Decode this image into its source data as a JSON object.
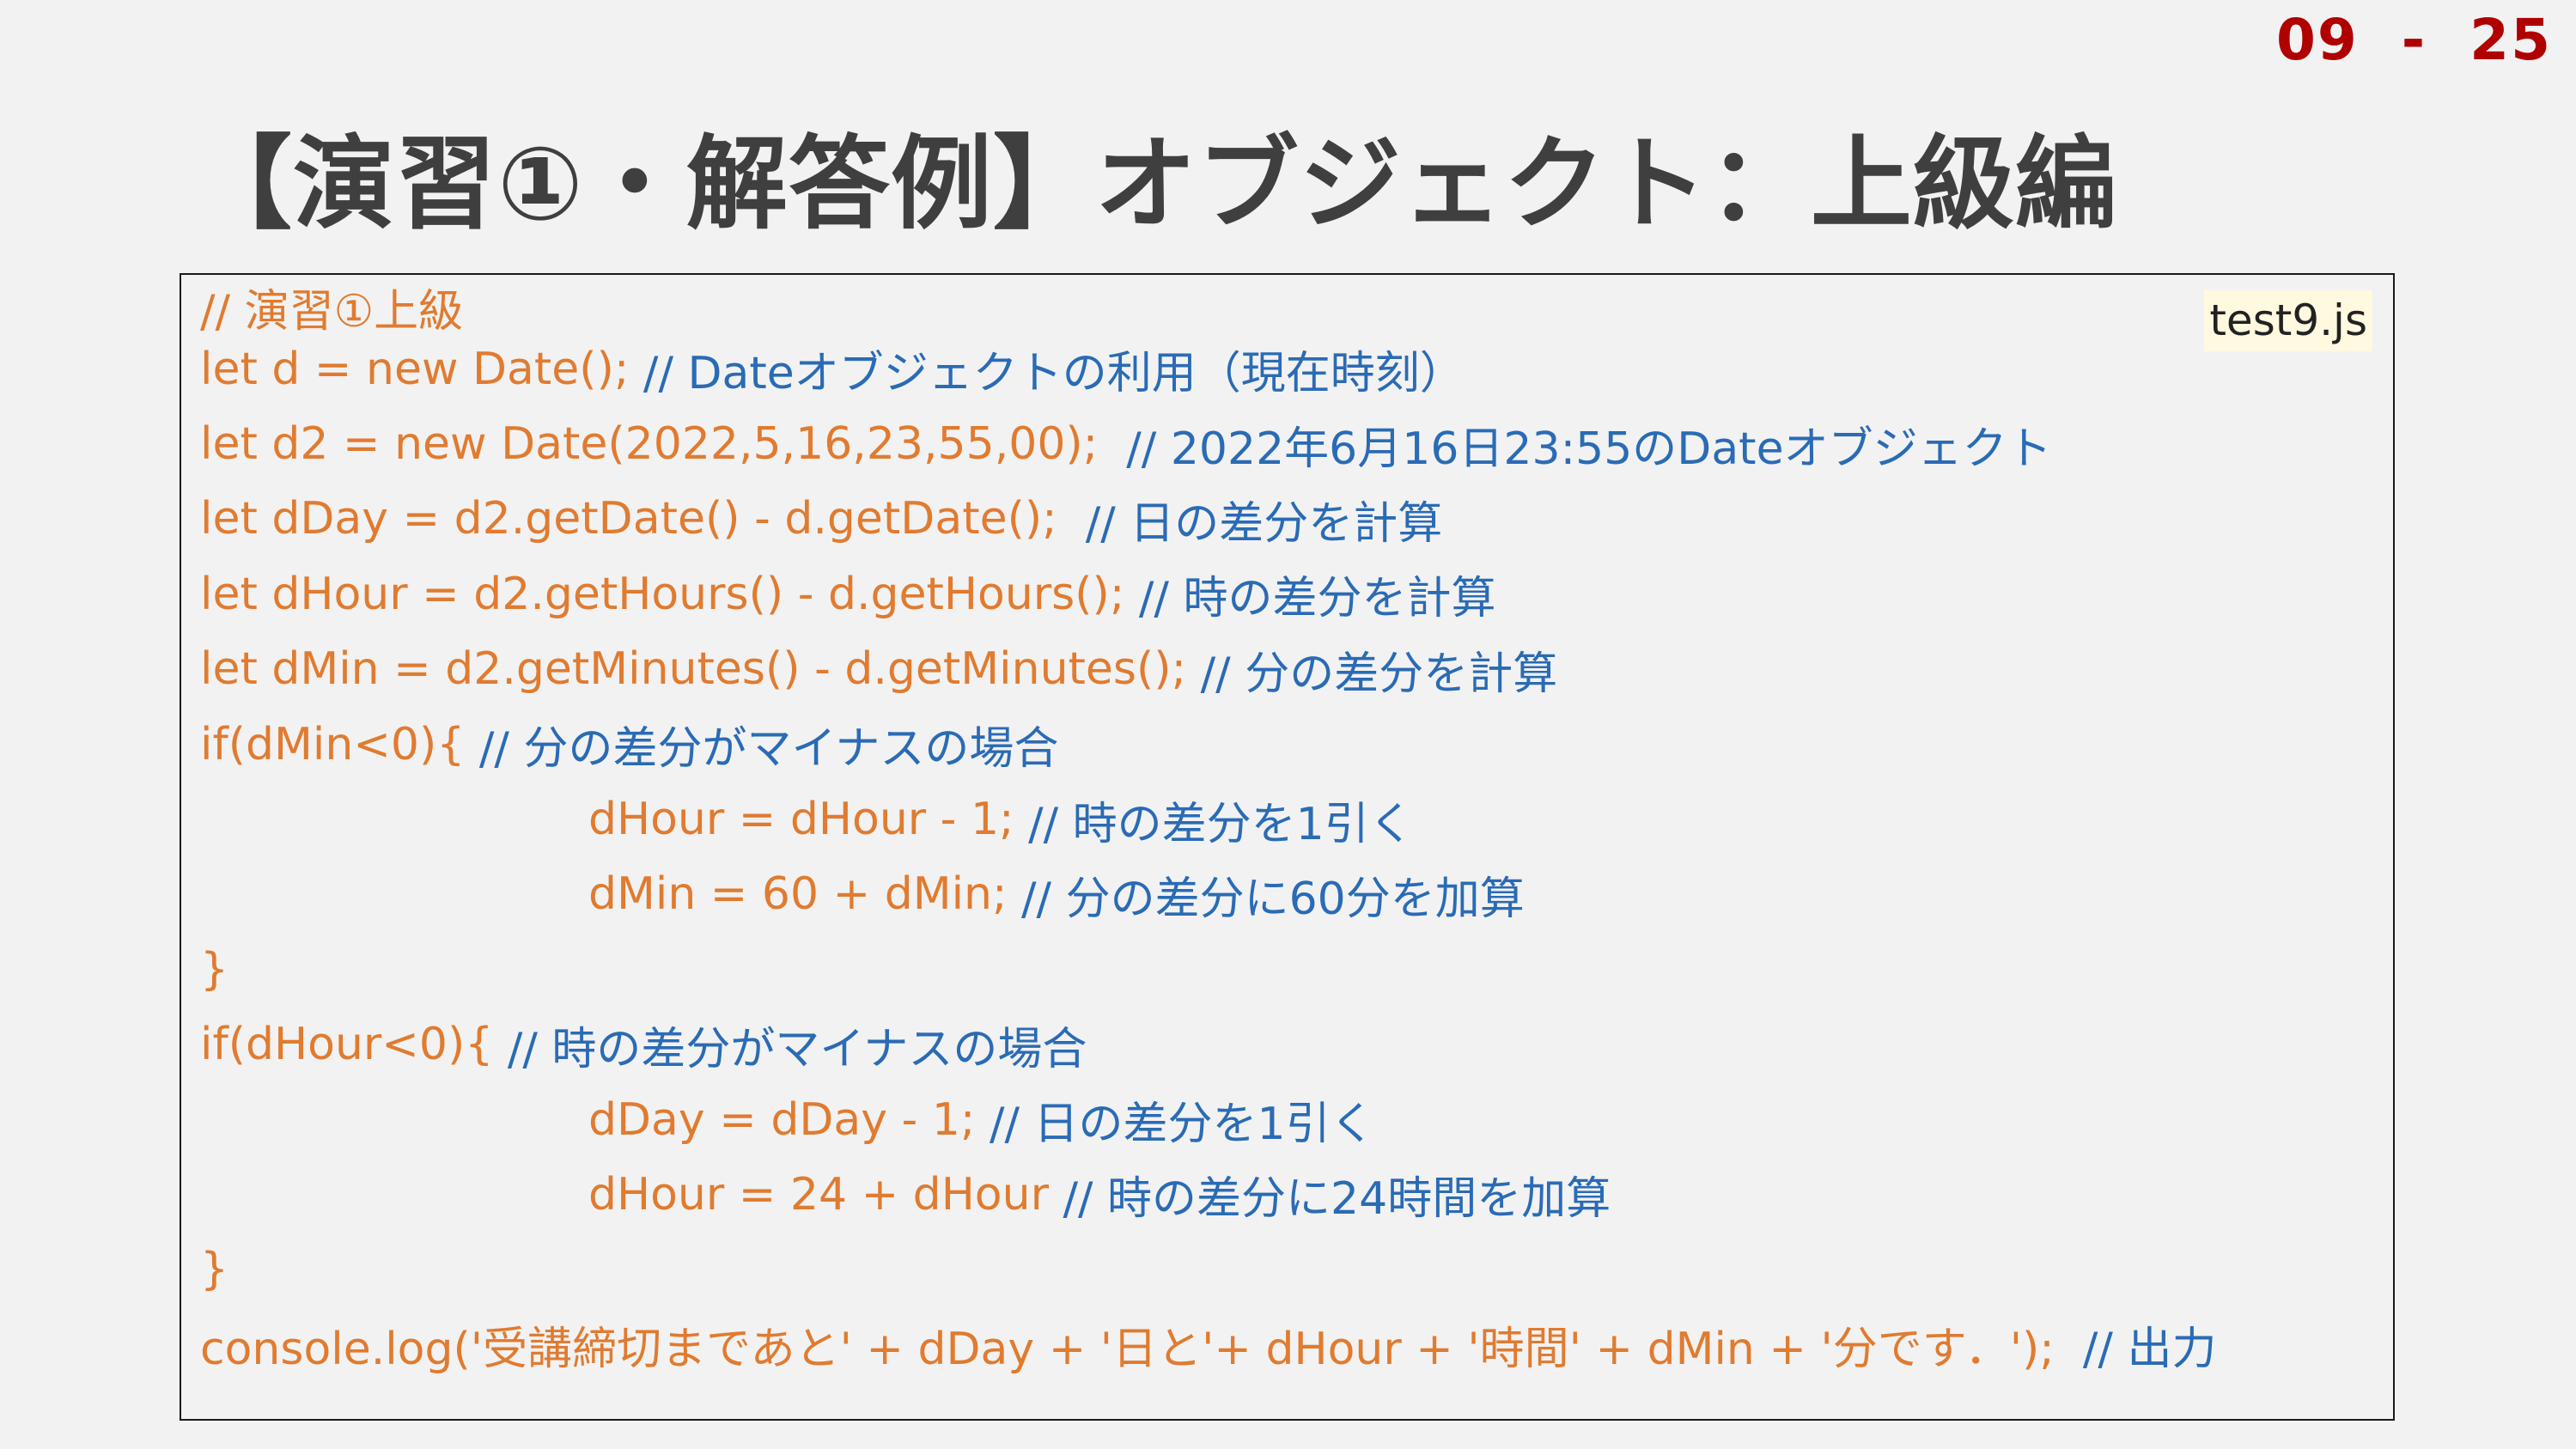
{
  "page_number": "09  -  25",
  "title": "【演習①・解答例】オブジェクト：上級編",
  "file_label": "test9.js",
  "code_lines": [
    {
      "code": "// 演習①上級",
      "comment": "",
      "indent": false
    },
    {
      "code": "let d = new Date(); ",
      "comment": "// Dateオブジェクトの利用（現在時刻）",
      "indent": false
    },
    {
      "code": "let d2 = new Date(2022,5,16,23,55,00);  ",
      "comment": "// 2022年6月16日23:55のDateオブジェクト",
      "indent": false
    },
    {
      "code": "let dDay = d2.getDate() - d.getDate();  ",
      "comment": "// 日の差分を計算",
      "indent": false
    },
    {
      "code": "let dHour = d2.getHours() - d.getHours(); ",
      "comment": "// 時の差分を計算",
      "indent": false
    },
    {
      "code": "let dMin = d2.getMinutes() - d.getMinutes(); ",
      "comment": "// 分の差分を計算",
      "indent": false
    },
    {
      "code": "if(dMin<0){ ",
      "comment": "// 分の差分がマイナスの場合",
      "indent": false
    },
    {
      "code": "dHour = dHour - 1; ",
      "comment": "// 時の差分を1引く",
      "indent": true
    },
    {
      "code": "dMin = 60 + dMin; ",
      "comment": "// 分の差分に60分を加算",
      "indent": true
    },
    {
      "code": "}",
      "comment": "",
      "indent": false
    },
    {
      "code": "if(dHour<0){ ",
      "comment": "// 時の差分がマイナスの場合",
      "indent": false
    },
    {
      "code": "dDay = dDay - 1; ",
      "comment": "// 日の差分を1引く",
      "indent": true
    },
    {
      "code": "dHour = 24 + dHour ",
      "comment": "// 時の差分に24時間を加算",
      "indent": true
    },
    {
      "code": "}",
      "comment": "",
      "indent": false
    },
    {
      "code": "console.log('受講締切まであと' + dDay + '日と'+ dHour + '時間' + dMin + '分です．');  ",
      "comment": "// 出力",
      "indent": false
    }
  ],
  "colors": {
    "background": "#f2f2f2",
    "title": "#3f3f3f",
    "page_number": "#b00000",
    "code": "#e07b30",
    "comment": "#2a6bb5",
    "file_label_bg": "#fff9e0"
  }
}
